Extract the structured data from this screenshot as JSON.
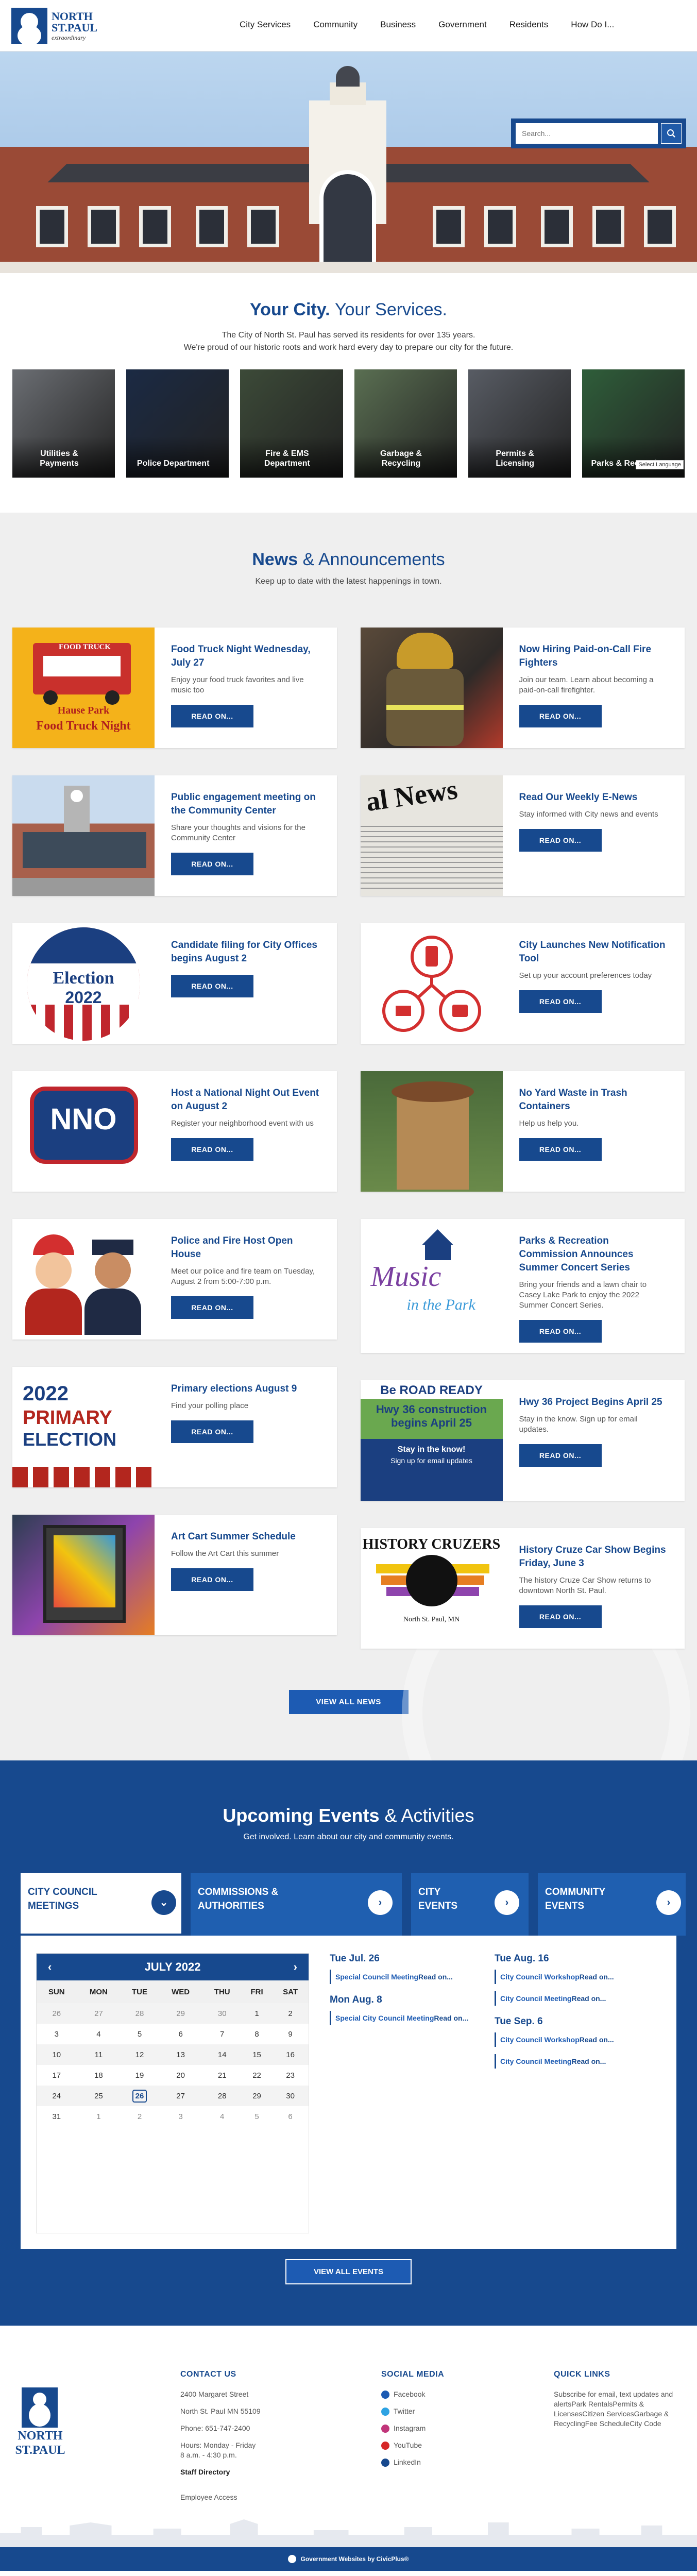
{
  "header": {
    "logo": {
      "line1": "NORTH",
      "line2": "ST.PAUL",
      "tagline": "extraordinary"
    },
    "nav": [
      "City Services",
      "Community",
      "Business",
      "Government",
      "Residents",
      "How Do I..."
    ]
  },
  "search": {
    "placeholder": "Search..."
  },
  "intro": {
    "title_strong": "Your City.",
    "title_light": "Your Services.",
    "line1": "The City of North St. Paul has served its residents for over 135 years.",
    "line2": "We're proud of our historic roots and work hard every day to prepare our city for the future."
  },
  "tiles": [
    {
      "label": "Utilities & Payments",
      "color": "#6b6e73"
    },
    {
      "label": "Police Department",
      "color": "#1b2a44"
    },
    {
      "label": "Fire & EMS Department",
      "color": "#3c4a38"
    },
    {
      "label": "Garbage & Recycling",
      "color": "#5a6f52"
    },
    {
      "label": "Permits & Licensing",
      "color": "#585c64"
    },
    {
      "label": "Parks & Recreation",
      "color": "#2f5e3a"
    }
  ],
  "translate": "Select Language",
  "news": {
    "title_strong": "News",
    "title_light": "& Announcements",
    "subtitle": "Keep up to date with the latest happenings in town.",
    "read_on": "READ ON...",
    "view_all": "VIEW ALL NEWS",
    "left": [
      {
        "title": "Food Truck Night Wednesday, July 27",
        "desc": "Enjoy your food truck favorites and live music too",
        "img": "food-truck",
        "img_text1": "FOOD TRUCK",
        "img_text2": "Hause Park",
        "img_text3": "Food Truck Night"
      },
      {
        "title": "Public engagement meeting on the Community Center",
        "desc": "Share your thoughts and visions for the Community Center",
        "img": "community-center"
      },
      {
        "title": "Candidate filing for City Offices begins August 2",
        "desc": "",
        "img": "election",
        "img_text1": "Election",
        "img_text2": "2022"
      },
      {
        "title": "Host a National Night Out Event on August 2",
        "desc": "Register your neighborhood event with us",
        "img": "nno",
        "img_text1": "NNO"
      },
      {
        "title": "Police and Fire Host Open House",
        "desc": "Meet our police and fire team on Tuesday, August 2 from 5:00-7:00 p.m.",
        "img": "police-fire"
      },
      {
        "title": "Primary elections August 9",
        "desc": "Find your polling place",
        "img": "primary",
        "img_text1": "2022",
        "img_text2": "PRIMARY",
        "img_text3": "ELECTION"
      },
      {
        "title": "Art Cart Summer Schedule",
        "desc": "Follow the Art Cart this summer",
        "img": "art-cart"
      }
    ],
    "right": [
      {
        "title": "Now Hiring Paid-on-Call Fire Fighters",
        "desc": "Join our team. Learn about becoming a paid-on-call firefighter.",
        "img": "firefighter"
      },
      {
        "title": "Read Our Weekly E-News",
        "desc": "Stay informed with City news and events",
        "img": "enews",
        "img_text1": "al News"
      },
      {
        "title": "City Launches New Notification Tool",
        "desc": "Set up your account preferences today",
        "img": "notification"
      },
      {
        "title": "No Yard Waste in Trash Containers",
        "desc": "Help us help you.",
        "img": "yard-waste"
      },
      {
        "title": "Parks & Recreation Commission Announces Summer Concert Series",
        "desc": "Bring your friends and a lawn chair to Casey Lake Park to enjoy the 2022 Summer Concert Series.",
        "img": "music-park",
        "img_text1": "Music",
        "img_text2": "in the Park"
      },
      {
        "title": "Hwy 36 Project Begins April 25",
        "desc": "Stay in the know. Sign up for email updates.",
        "img": "hwy36",
        "img_text1": "Be ROAD READY",
        "img_text2": "Hwy 36 construction begins April 25",
        "img_text3": "Stay in the know!",
        "img_text4": "Sign up for email updates"
      },
      {
        "title": "History Cruze Car Show Begins Friday, June 3",
        "desc": "The history Cruze Car Show returns to downtown North St. Paul.",
        "img": "cruzers",
        "img_text1": "HISTORY CRUZERS",
        "img_text2": "North St. Paul, MN"
      }
    ]
  },
  "events": {
    "title_strong": "Upcoming Events",
    "title_light": "& Activities",
    "subtitle": "Get involved. Learn about our city and community events.",
    "tabs": [
      "CITY COUNCIL MEETINGS",
      "COMMISSIONS & AUTHORITIES",
      "CITY EVENTS",
      "COMMUNITY EVENTS"
    ],
    "calendar": {
      "month": "JULY 2022",
      "days": [
        "SUN",
        "MON",
        "TUE",
        "WED",
        "THU",
        "FRI",
        "SAT"
      ],
      "weeks": [
        [
          "26",
          "27",
          "28",
          "29",
          "30",
          "1",
          "2"
        ],
        [
          "3",
          "4",
          "5",
          "6",
          "7",
          "8",
          "9"
        ],
        [
          "10",
          "11",
          "12",
          "13",
          "14",
          "15",
          "16"
        ],
        [
          "17",
          "18",
          "19",
          "20",
          "21",
          "22",
          "23"
        ],
        [
          "24",
          "25",
          "26",
          "27",
          "28",
          "29",
          "30"
        ],
        [
          "31",
          "1",
          "2",
          "3",
          "4",
          "5",
          "6"
        ]
      ],
      "today": "26"
    },
    "read_on": "Read on...",
    "list_left": [
      {
        "date": "Tue Jul. 26",
        "items": [
          "Special Council Meeting"
        ]
      },
      {
        "date": "Mon Aug. 8",
        "items": [
          "Special City Council Meeting"
        ]
      }
    ],
    "list_right": [
      {
        "date": "Tue Aug. 16",
        "items": [
          "City Council Workshop",
          "City Council Meeting"
        ]
      },
      {
        "date": "Tue Sep. 6",
        "items": [
          "City Council Workshop",
          "City Council Meeting"
        ]
      }
    ],
    "view_all": "VIEW ALL EVENTS"
  },
  "footer": {
    "logo1": "NORTH",
    "logo2": "ST.PAUL",
    "contact": {
      "title": "CONTACT US",
      "address1": "2400 Margaret Street",
      "address2": "North St. Paul MN 55109",
      "phone": "Phone: 651-747-2400",
      "hours1": "Hours: Monday - Friday",
      "hours2": "8 a.m. - 4:30 p.m.",
      "staff": "Staff Directory",
      "employee": "Employee Access"
    },
    "social": {
      "title": "SOCIAL MEDIA",
      "items": [
        {
          "label": "Facebook",
          "color": "#1d5bb3"
        },
        {
          "label": "Twitter",
          "color": "#2ea3e3"
        },
        {
          "label": "Instagram",
          "color": "#c1357a"
        },
        {
          "label": "YouTube",
          "color": "#d62828"
        },
        {
          "label": "LinkedIn",
          "color": "#17498e"
        }
      ]
    },
    "quick": {
      "title": "QUICK LINKS",
      "items": [
        "Subscribe for email, text updates and alerts",
        "Park Rentals",
        "Permits & Licenses",
        "Citizen Services",
        "Garbage & Recycling",
        "Fee Schedule",
        "City Code"
      ]
    },
    "bottom": "Government Websites by CivicPlus®"
  }
}
